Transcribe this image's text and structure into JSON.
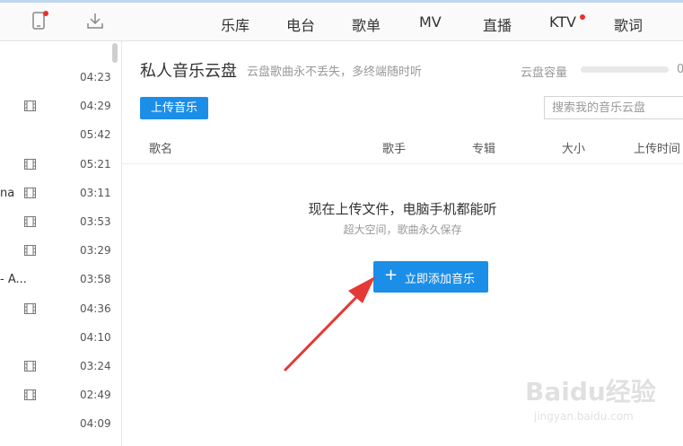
{
  "top_nav": {
    "items": [
      "乐库",
      "电台",
      "歌单",
      "MV",
      "直播",
      "KTV",
      "歌词"
    ]
  },
  "sidebar": {
    "songs": [
      {
        "title": "",
        "duration": "04:23",
        "has_mv": false
      },
      {
        "title": "",
        "duration": "04:29",
        "has_mv": true
      },
      {
        "title": "",
        "duration": "05:42",
        "has_mv": false
      },
      {
        "title": "",
        "duration": "05:21",
        "has_mv": true
      },
      {
        "title": "na",
        "duration": "03:11",
        "has_mv": true
      },
      {
        "title": "",
        "duration": "03:53",
        "has_mv": true
      },
      {
        "title": "",
        "duration": "03:29",
        "has_mv": true
      },
      {
        "title": "- A...",
        "duration": "03:58",
        "has_mv": false
      },
      {
        "title": "",
        "duration": "04:36",
        "has_mv": true
      },
      {
        "title": "",
        "duration": "04:10",
        "has_mv": false
      },
      {
        "title": "",
        "duration": "03:24",
        "has_mv": true
      },
      {
        "title": "",
        "duration": "02:49",
        "has_mv": true
      },
      {
        "title": "",
        "duration": "04:09",
        "has_mv": false
      }
    ]
  },
  "cloud": {
    "title": "私人音乐云盘",
    "subtitle": "云盘歌曲永不丢失，多终端随时听",
    "capacity_label": "云盘容量",
    "capacity_value": "0",
    "upload_button": "上传音乐",
    "search_placeholder": "搜索我的音乐云盘",
    "columns": {
      "name": "歌名",
      "artist": "歌手",
      "album": "专辑",
      "size": "大小",
      "upload_time": "上传时间"
    },
    "empty_title": "现在上传文件，电脑手机都能听",
    "empty_sub": "超大空间，歌曲永久保存",
    "add_button_icon": "+",
    "add_button": "立即添加音乐"
  },
  "watermark": {
    "logo": "Baidu经验",
    "url": "jingyan.baidu.com"
  },
  "colors": {
    "accent": "#1b8ee8",
    "notification": "#ee2d2d",
    "annotation_arrow": "#e53935"
  }
}
